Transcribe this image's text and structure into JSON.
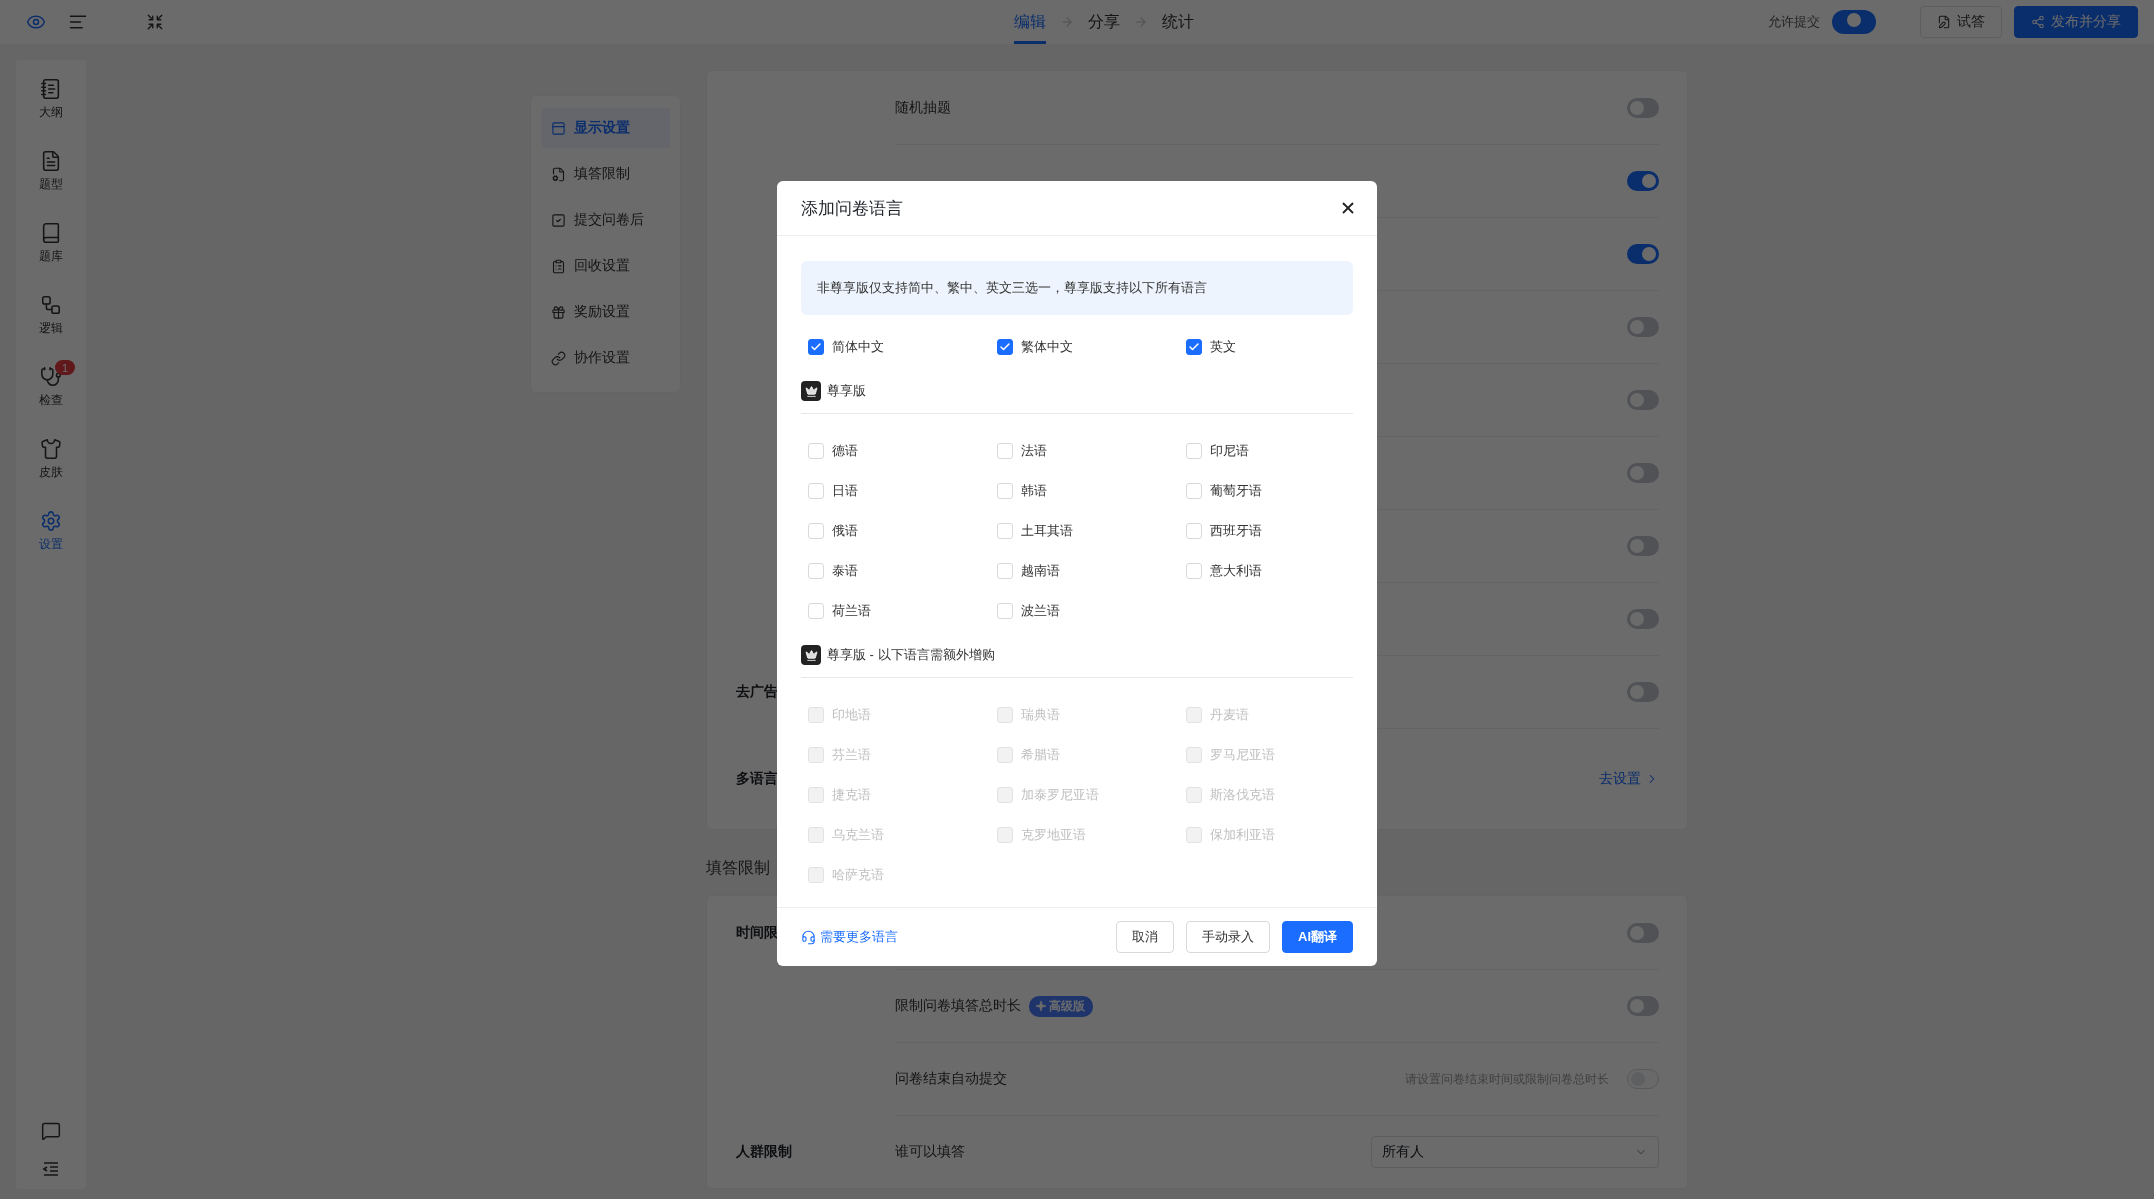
{
  "topbar": {
    "tabs": [
      {
        "label": "编辑",
        "selected": true
      },
      {
        "label": "分享",
        "selected": false
      },
      {
        "label": "统计",
        "selected": false
      }
    ],
    "allow_submit": {
      "label": "允许提交",
      "on": true
    },
    "buttons": [
      {
        "label": "试答",
        "kind": "outline"
      },
      {
        "label": "发布并分享",
        "kind": "primary"
      }
    ]
  },
  "rail": {
    "items": [
      {
        "label": "大纲",
        "selected": false
      },
      {
        "label": "题型",
        "selected": false
      },
      {
        "label": "题库",
        "selected": false
      },
      {
        "label": "逻辑",
        "selected": false
      },
      {
        "label": "检查",
        "selected": false,
        "badge": "1"
      },
      {
        "label": "皮肤",
        "selected": false
      },
      {
        "label": "设置",
        "selected": true
      }
    ]
  },
  "settings_nav": {
    "items": [
      {
        "label": "显示设置",
        "selected": true
      },
      {
        "label": "填答限制",
        "selected": false
      },
      {
        "label": "提交问卷后",
        "selected": false
      },
      {
        "label": "回收设置",
        "selected": false
      },
      {
        "label": "奖励设置",
        "selected": false
      },
      {
        "label": "协作设置",
        "selected": false
      }
    ]
  },
  "display_settings": {
    "rows": [
      {
        "label": "随机抽题",
        "on": false
      },
      {
        "on": true
      },
      {
        "on": true
      },
      {
        "on": false
      },
      {
        "on": false
      },
      {
        "on": false
      },
      {
        "on": false
      },
      {
        "on": false
      },
      {
        "group": "去广告",
        "on": false
      },
      {
        "group": "多语言",
        "link": "去设置"
      }
    ]
  },
  "fill_limits": {
    "title": "填答限制",
    "rows": [
      {
        "group": "时间限",
        "on": false,
        "disabled": false
      },
      {
        "label": "限制问卷填答总时长",
        "badge": "高级版",
        "on": false,
        "disabled": false
      },
      {
        "label": "问卷结束自动提交",
        "hint": "请设置问卷结束时间或限制问卷总时长",
        "on": false,
        "disabled": true
      },
      {
        "group": "人群限制",
        "label": "谁可以填答",
        "select": "所有人"
      }
    ]
  },
  "dialog": {
    "title": "添加问卷语言",
    "notice": "非尊享版仅支持简中、繁中、英文三选一，尊享版支持以下所有语言",
    "basic": [
      {
        "label": "简体中文",
        "checked": true
      },
      {
        "label": "繁体中文",
        "checked": true
      },
      {
        "label": "英文",
        "checked": true
      }
    ],
    "sections": [
      {
        "title": "尊享版",
        "disabled": false,
        "languages": [
          {
            "label": "德语",
            "checked": false
          },
          {
            "label": "法语",
            "checked": false
          },
          {
            "label": "印尼语",
            "checked": false
          },
          {
            "label": "日语",
            "checked": false
          },
          {
            "label": "韩语",
            "checked": false
          },
          {
            "label": "葡萄牙语",
            "checked": false
          },
          {
            "label": "俄语",
            "checked": false
          },
          {
            "label": "土耳其语",
            "checked": false
          },
          {
            "label": "西班牙语",
            "checked": false
          },
          {
            "label": "泰语",
            "checked": false
          },
          {
            "label": "越南语",
            "checked": false
          },
          {
            "label": "意大利语",
            "checked": false
          },
          {
            "label": "荷兰语",
            "checked": false
          },
          {
            "label": "波兰语",
            "checked": false
          }
        ]
      },
      {
        "title": "尊享版 - 以下语言需额外增购",
        "disabled": true,
        "languages": [
          {
            "label": "印地语",
            "checked": false
          },
          {
            "label": "瑞典语",
            "checked": false
          },
          {
            "label": "丹麦语",
            "checked": false
          },
          {
            "label": "芬兰语",
            "checked": false
          },
          {
            "label": "希腊语",
            "checked": false
          },
          {
            "label": "罗马尼亚语",
            "checked": false
          },
          {
            "label": "捷克语",
            "checked": false
          },
          {
            "label": "加泰罗尼亚语",
            "checked": false
          },
          {
            "label": "斯洛伐克语",
            "checked": false
          },
          {
            "label": "乌克兰语",
            "checked": false
          },
          {
            "label": "克罗地亚语",
            "checked": false
          },
          {
            "label": "保加利亚语",
            "checked": false
          },
          {
            "label": "哈萨克语",
            "checked": false
          }
        ]
      }
    ],
    "help_link": "需要更多语言",
    "buttons": [
      {
        "label": "取消",
        "kind": "default"
      },
      {
        "label": "手动录入",
        "kind": "default"
      },
      {
        "label": "AI翻译",
        "kind": "primary"
      }
    ]
  }
}
